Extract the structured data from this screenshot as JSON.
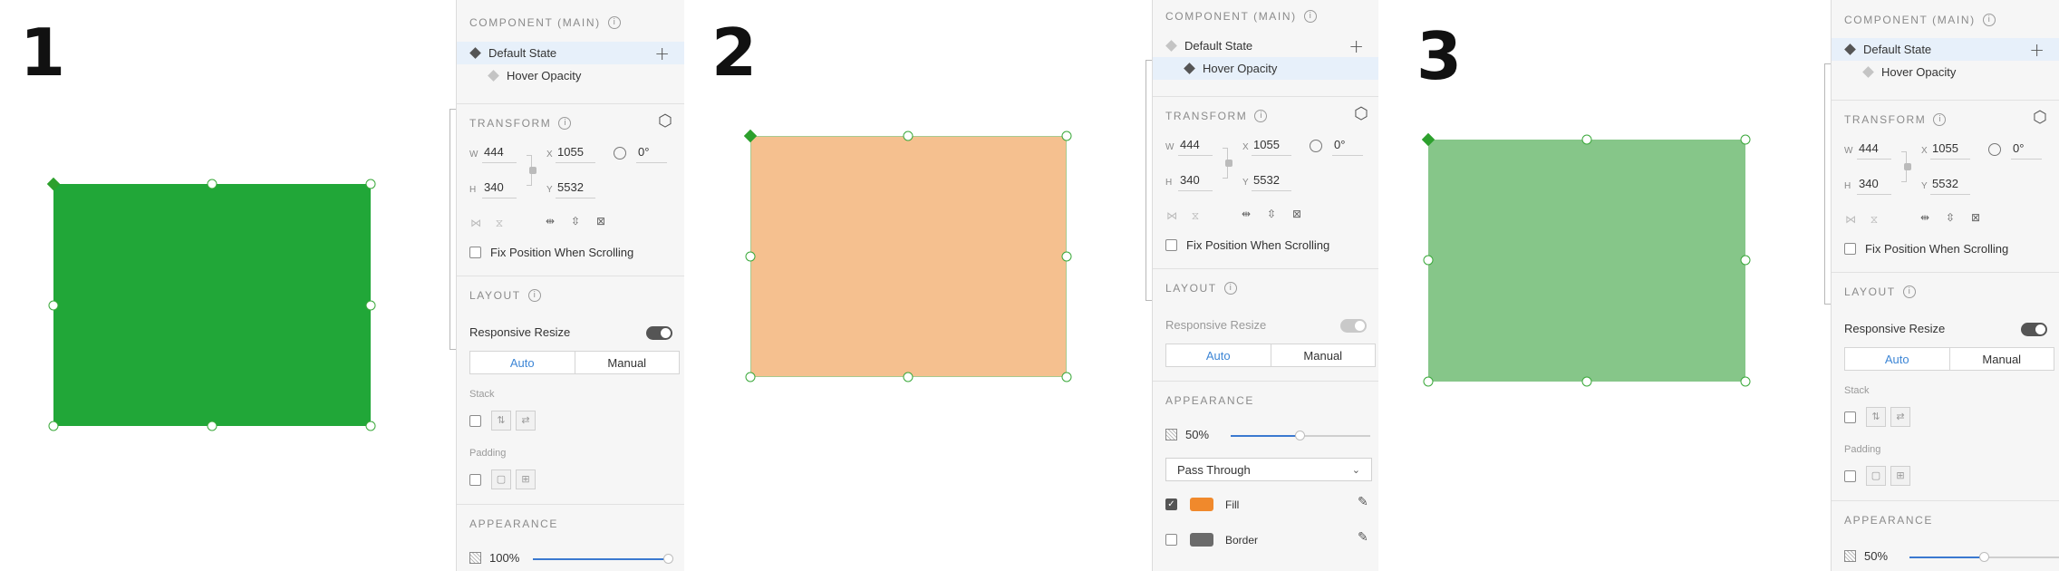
{
  "steps": [
    {
      "number": "1",
      "rect_color": "#21a738",
      "panel": {
        "component_title": "COMPONENT (MAIN)",
        "states": [
          {
            "label": "Default State",
            "selected": true
          },
          {
            "label": "Hover Opacity",
            "selected": false
          }
        ],
        "transform_title": "TRANSFORM",
        "w_label": "W",
        "w_value": "444",
        "x_label": "X",
        "x_value": "1055",
        "h_label": "H",
        "h_value": "340",
        "y_label": "Y",
        "y_value": "5532",
        "rotation": "0°",
        "fix_position_label": "Fix Position When Scrolling",
        "layout_title": "LAYOUT",
        "responsive_label": "Responsive Resize",
        "auto_label": "Auto",
        "manual_label": "Manual",
        "stack_label": "Stack",
        "padding_label": "Padding",
        "appearance_title": "APPEARANCE",
        "opacity": "100%",
        "opacity_fraction": 1.0
      }
    },
    {
      "number": "2",
      "rect_color": "#f5c08f",
      "panel": {
        "component_title": "COMPONENT (MAIN)",
        "states": [
          {
            "label": "Default State",
            "selected": false
          },
          {
            "label": "Hover Opacity",
            "selected": true
          }
        ],
        "transform_title": "TRANSFORM",
        "w_label": "W",
        "w_value": "444",
        "x_label": "X",
        "x_value": "1055",
        "h_label": "H",
        "h_value": "340",
        "y_label": "Y",
        "y_value": "5532",
        "rotation": "0°",
        "fix_position_label": "Fix Position When Scrolling",
        "layout_title": "LAYOUT",
        "responsive_label": "Responsive Resize",
        "auto_label": "Auto",
        "manual_label": "Manual",
        "appearance_title": "APPEARANCE",
        "opacity": "50%",
        "opacity_fraction": 0.5,
        "blend_mode": "Pass Through",
        "fill_label": "Fill",
        "fill_color": "#f0892c",
        "border_label": "Border",
        "border_color": "#6b6b6b"
      }
    },
    {
      "number": "3",
      "rect_color": "#86c689",
      "panel": {
        "component_title": "COMPONENT (MAIN)",
        "states": [
          {
            "label": "Default State",
            "selected": true
          },
          {
            "label": "Hover Opacity",
            "selected": false
          }
        ],
        "transform_title": "TRANSFORM",
        "w_label": "W",
        "w_value": "444",
        "x_label": "X",
        "x_value": "1055",
        "h_label": "H",
        "h_value": "340",
        "y_label": "Y",
        "y_value": "5532",
        "rotation": "0°",
        "fix_position_label": "Fix Position When Scrolling",
        "layout_title": "LAYOUT",
        "responsive_label": "Responsive Resize",
        "auto_label": "Auto",
        "manual_label": "Manual",
        "stack_label": "Stack",
        "padding_label": "Padding",
        "appearance_title": "APPEARANCE",
        "opacity": "50%",
        "opacity_fraction": 0.5
      }
    }
  ]
}
